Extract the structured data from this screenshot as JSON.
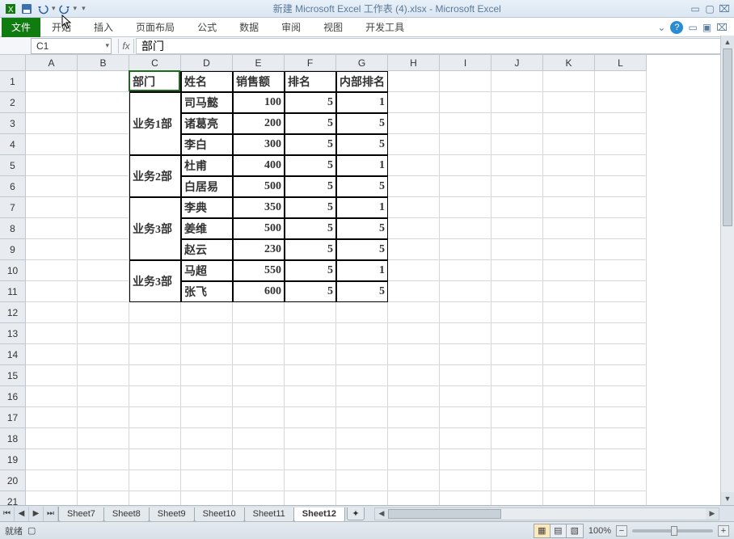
{
  "title": "新建 Microsoft Excel 工作表 (4).xlsx  -  Microsoft Excel",
  "ribbon": {
    "file": "文件",
    "tabs": [
      "开始",
      "插入",
      "页面布局",
      "公式",
      "数据",
      "审阅",
      "视图",
      "开发工具"
    ]
  },
  "name_box": "C1",
  "formula_value": "部门",
  "columns": [
    "A",
    "B",
    "C",
    "D",
    "E",
    "F",
    "G",
    "H",
    "I",
    "J",
    "K",
    "L"
  ],
  "row_count": 21,
  "chart_data": {
    "type": "table",
    "headers": {
      "C": "部门",
      "D": "姓名",
      "E": "销售额",
      "F": "排名",
      "G": "内部排名"
    },
    "rows": [
      {
        "dept": "业务1部",
        "span": 3,
        "people": [
          {
            "name": "司马懿",
            "sales": 100,
            "rank": 5,
            "inner": 1
          },
          {
            "name": "诸葛亮",
            "sales": 200,
            "rank": 5,
            "inner": 5
          },
          {
            "name": "李白",
            "sales": 300,
            "rank": 5,
            "inner": 5
          }
        ]
      },
      {
        "dept": "业务2部",
        "span": 2,
        "people": [
          {
            "name": "杜甫",
            "sales": 400,
            "rank": 5,
            "inner": 1
          },
          {
            "name": "白居易",
            "sales": 500,
            "rank": 5,
            "inner": 5
          }
        ]
      },
      {
        "dept": "业务3部",
        "span": 3,
        "people": [
          {
            "name": "李典",
            "sales": 350,
            "rank": 5,
            "inner": 1
          },
          {
            "name": "姜维",
            "sales": 500,
            "rank": 5,
            "inner": 5
          },
          {
            "name": "赵云",
            "sales": 230,
            "rank": 5,
            "inner": 5
          }
        ]
      },
      {
        "dept": "业务3部",
        "span": 2,
        "people": [
          {
            "name": "马超",
            "sales": 550,
            "rank": 5,
            "inner": 1
          },
          {
            "name": "张飞",
            "sales": 600,
            "rank": 5,
            "inner": 5
          }
        ]
      }
    ]
  },
  "sheet_tabs": [
    "Sheet7",
    "Sheet8",
    "Sheet9",
    "Sheet10",
    "Sheet11",
    "Sheet12"
  ],
  "active_sheet": "Sheet12",
  "status": {
    "ready": "就绪",
    "zoom": "100%"
  },
  "active_cell": {
    "row": 1,
    "col": "C"
  }
}
